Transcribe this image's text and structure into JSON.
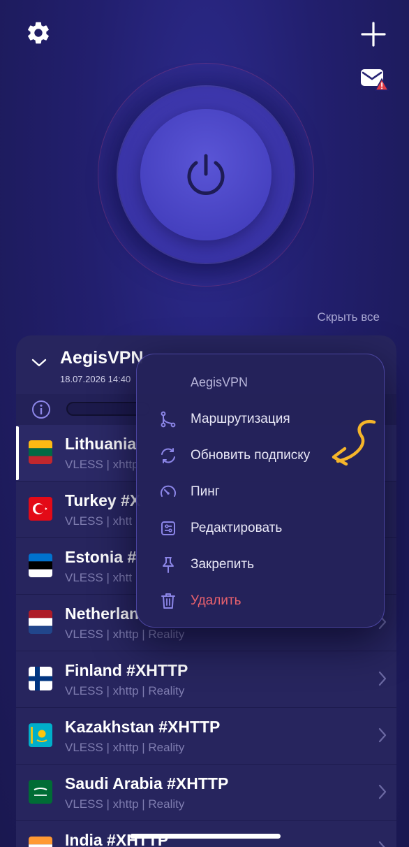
{
  "header": {
    "settings_icon": "gear-icon",
    "add_icon": "plus-icon",
    "mail_icon": "mail-alert-icon"
  },
  "power": {
    "icon": "power-icon",
    "state": "disconnected"
  },
  "hide_all_label": "Скрыть все",
  "subscription": {
    "name": "AegisVPN",
    "updated": "18.07.2026 14:40"
  },
  "servers": [
    {
      "name": "Lithuania",
      "meta": "VLESS | xhttp",
      "flag": "lithuania-flag",
      "active": true
    },
    {
      "name": "Turkey #X",
      "meta": "VLESS | xhtt",
      "flag": "turkey-flag"
    },
    {
      "name": "Estonia #",
      "meta": "VLESS | xhtt",
      "flag": "estonia-flag"
    },
    {
      "name": "Netherlan",
      "meta": "VLESS | xhttp | Reality",
      "flag": "netherlands-flag"
    },
    {
      "name": "Finland #XHTTP",
      "meta": "VLESS | xhttp | Reality",
      "flag": "finland-flag"
    },
    {
      "name": "Kazakhstan #XHTTP",
      "meta": "VLESS | xhttp | Reality",
      "flag": "kazakhstan-flag"
    },
    {
      "name": "Saudi Arabia #XHTTP",
      "meta": "VLESS | xhttp | Reality",
      "flag": "saudi-arabia-flag"
    },
    {
      "name": "India #XHTTP",
      "meta": "",
      "flag": "india-flag"
    }
  ],
  "context_menu": {
    "title": "AegisVPN",
    "items": [
      {
        "label": "Маршрутизация",
        "icon": "routing-icon"
      },
      {
        "label": "Обновить подписку",
        "icon": "refresh-icon"
      },
      {
        "label": "Пинг",
        "icon": "ping-gauge-icon"
      },
      {
        "label": "Редактировать",
        "icon": "sliders-icon"
      },
      {
        "label": "Закрепить",
        "icon": "pin-icon"
      },
      {
        "label": "Удалить",
        "icon": "trash-icon",
        "danger": true
      }
    ]
  },
  "colors": {
    "background": "#221f6e",
    "card": "#27255e",
    "accent": "#7c74f0",
    "danger": "#e8616d",
    "annotation": "#f5b52a"
  }
}
